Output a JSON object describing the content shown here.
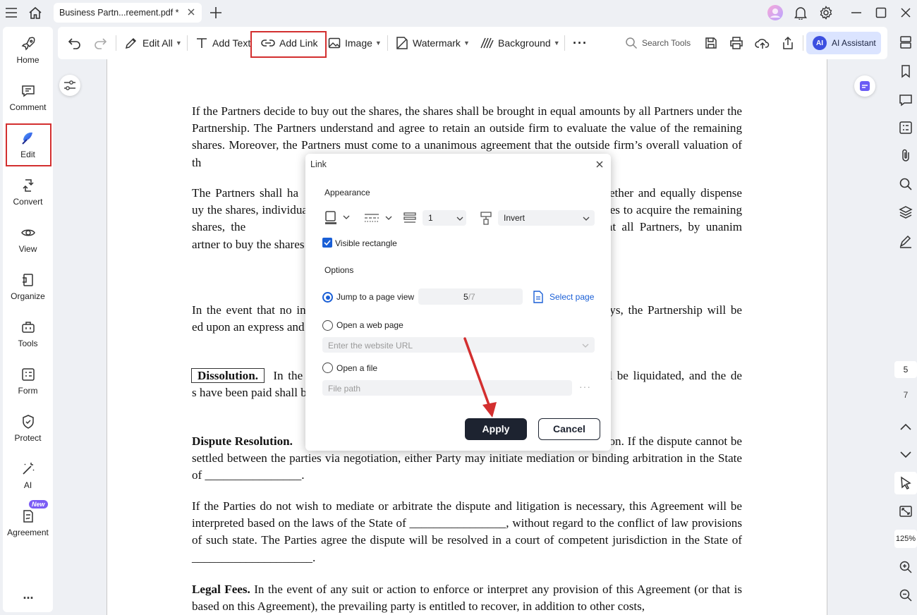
{
  "titlebar": {
    "tab_title": "Business Partn...reement.pdf *"
  },
  "sidebar": {
    "items": [
      {
        "label": "Home",
        "icon": "rocket-icon"
      },
      {
        "label": "Comment",
        "icon": "comment-icon"
      },
      {
        "label": "Edit",
        "icon": "edit-icon"
      },
      {
        "label": "Convert",
        "icon": "convert-icon"
      },
      {
        "label": "View",
        "icon": "eye-icon"
      },
      {
        "label": "Organize",
        "icon": "organize-icon"
      },
      {
        "label": "Tools",
        "icon": "toolbox-icon"
      },
      {
        "label": "Form",
        "icon": "form-icon"
      },
      {
        "label": "Protect",
        "icon": "shield-icon"
      },
      {
        "label": "AI",
        "icon": "magic-wand-icon"
      },
      {
        "label": "Agreement",
        "icon": "agreement-icon"
      }
    ],
    "new_badge": "New",
    "more": "..."
  },
  "toolbar": {
    "edit_all": "Edit All",
    "add_text": "Add Text",
    "add_link": "Add Link",
    "image": "Image",
    "watermark": "Watermark",
    "background": "Background",
    "search_tools": "Search Tools",
    "ai_assistant": "AI Assistant",
    "ai_badge": "AI"
  },
  "page_nav": {
    "current_page": "5",
    "total_pages": "7",
    "zoom": "125%"
  },
  "document": {
    "p1": "If the Partners decide to buy out the shares, the shares shall be brought in equal amounts by all Partners under the Partnership. The Partners understand and agree to retain an outside firm to evaluate the value of the remaining shares. Moreover, the Partners must come to a unanimous agreement that the outside firm’s overall valuation of th",
    "p2": "The Partners shall ha                                            remaining shares together and equally dispense                                            uy the shares, individual Partners shall have th                                           tner wishes to acquire the remaining shares, the                                           tners. In the event that all Partners, by unanim                                            artner to buy the shares effectively replacing t",
    "p3": "In the event that no in                                            nt within _____ days, the Partnership will be                                             ed upon an express and unanimous vote of all",
    "p4_head": "Dissolution.",
    "p4": "  In the                                            the Partnership shall be liquidated, and the de                                            s have been paid shall be distributed based on th                                            ment.",
    "p5_head": "Dispute Resolution.",
    "p5": "                                            ispute through good-faith negotiation. If the dispute cannot be settled between the parties via negotiation, either Party may initiate mediation or binding arbitration in the State of ________________.",
    "p6": "If the Parties do not wish to mediate or arbitrate the dispute and litigation is necessary, this Agreement will be interpreted based on the laws of the State of ________________, without regard to the conflict of law provisions of such state. The Parties agree the dispute will be resolved in a court of competent jurisdiction in the State of ____________________.",
    "p7_head": "Legal Fees.",
    "p7": " In the event of any suit or action to enforce or interpret any provision of this Agreement (or that is based on this Agreement), the prevailing party is entitled to recover, in addition to other costs,"
  },
  "link_dialog": {
    "title": "Link",
    "appearance_heading": "Appearance",
    "line_width": "1",
    "highlight_style": "Invert",
    "visible_rectangle_label": "Visible rectangle",
    "visible_rectangle_checked": true,
    "options_heading": "Options",
    "jump_label": "Jump to a page view",
    "jump_page": "5",
    "jump_total": "/7",
    "select_page": "Select page",
    "web_label": "Open a web page",
    "web_placeholder": "Enter the website URL",
    "file_label": "Open a file",
    "file_placeholder": "File path",
    "apply": "Apply",
    "cancel": "Cancel"
  },
  "colors": {
    "accent": "#1a5fd6",
    "highlight_box": "#d32f2f",
    "primary_button": "#1d2330",
    "ai_button_bg": "#dbe4ff"
  }
}
